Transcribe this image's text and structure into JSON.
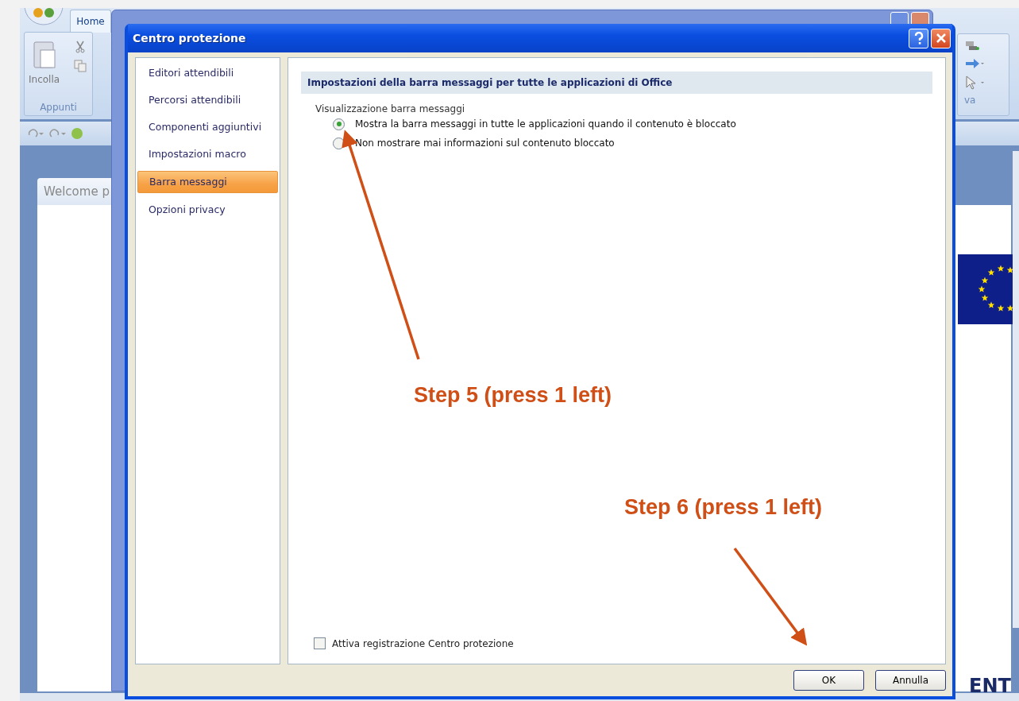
{
  "background_app": {
    "tab": "Home",
    "paste_label": "Incolla",
    "group_label": "Appunti",
    "group_label_2": "va",
    "document_tab": "Welcome p",
    "document_text": "ENT"
  },
  "dialog": {
    "title": "Centro protezione",
    "nav": [
      {
        "label": "Editori attendibili",
        "selected": false
      },
      {
        "label": "Percorsi attendibili",
        "selected": false
      },
      {
        "label": "Componenti aggiuntivi",
        "selected": false
      },
      {
        "label": "Impostazioni macro",
        "selected": false
      },
      {
        "label": "Barra messaggi",
        "selected": true
      },
      {
        "label": "Opzioni privacy",
        "selected": false
      }
    ],
    "section_header": "Impostazioni della barra messaggi per tutte le applicazioni di Office",
    "group_label": "Visualizzazione barra messaggi",
    "options": [
      {
        "label": "Mostra la barra messaggi in tutte le applicazioni quando il contenuto è bloccato",
        "selected": true
      },
      {
        "label": "Non mostrare mai informazioni sul contenuto bloccato",
        "selected": false
      }
    ],
    "checkbox": {
      "label": "Attiva registrazione Centro protezione",
      "checked": false
    },
    "buttons": [
      "OK",
      "Annulla"
    ]
  },
  "annotations": [
    {
      "label": "Step 5 (press 1 left)"
    },
    {
      "label": "Step 6 (press 1 left)"
    }
  ]
}
